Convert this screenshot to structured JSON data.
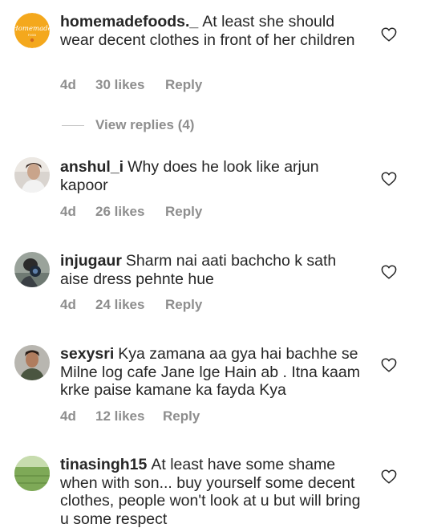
{
  "comments": [
    {
      "username": "homemadefoods._",
      "text": "At least she should wear decent clothes in front of her children",
      "time": "4d",
      "likes": "30 likes",
      "reply": "Reply",
      "avatar_text": "Homemade",
      "avatar_color": "#f5a623"
    },
    {
      "username": "anshul_i",
      "text": "Why does he look like arjun kapoor",
      "time": "4d",
      "likes": "26 likes",
      "reply": "Reply"
    },
    {
      "username": "injugaur",
      "text": "Sharm nai aati bachcho k sath aise dress pehnte hue",
      "time": "4d",
      "likes": "24 likes",
      "reply": "Reply"
    },
    {
      "username": "sexysri",
      "text": "Kya zamana aa gya hai bachhe se Milne log cafe Jane lge Hain ab . Itna kaam krke paise kamane ka fayda Kya",
      "time": "4d",
      "likes": "12 likes",
      "reply": "Reply"
    },
    {
      "username": "tinasingh15",
      "text": "At least have some shame when with son... buy yourself some decent clothes, people won't look at u but will bring u some respect",
      "time": "",
      "likes": "",
      "reply": ""
    }
  ],
  "view_replies": "View replies (4)"
}
